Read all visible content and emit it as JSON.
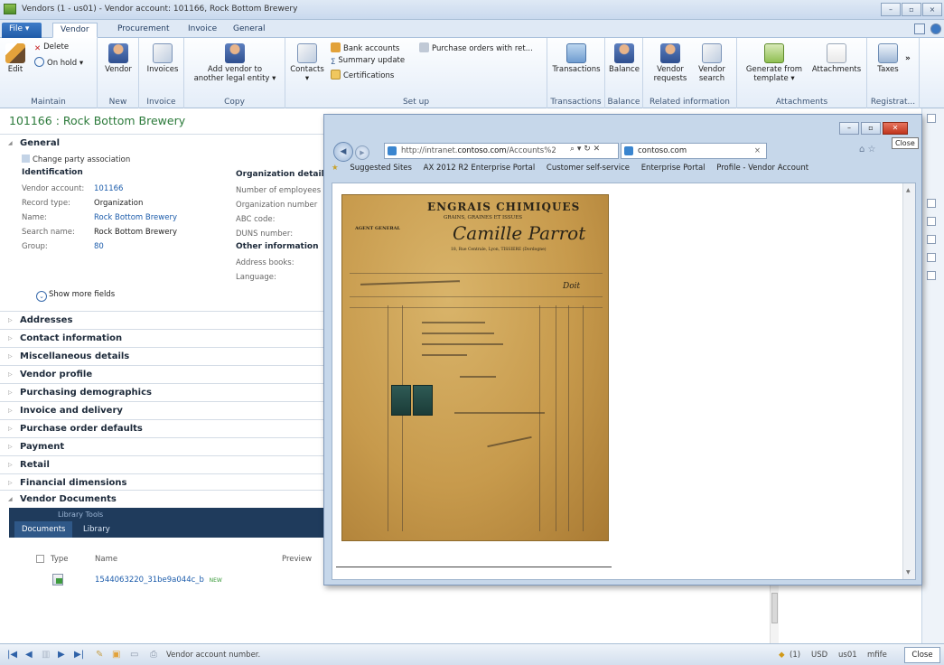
{
  "window": {
    "title": "Vendors (1 - us01) - Vendor account: 101166, Rock Bottom Brewery"
  },
  "tabs": [
    "File",
    "Vendor",
    "Procurement",
    "Invoice",
    "General"
  ],
  "ribbon": {
    "maintain": {
      "edit": "Edit",
      "delete": "Delete",
      "on_hold": "On hold",
      "label": "Maintain"
    },
    "new": {
      "vendor": "Vendor",
      "label": "New"
    },
    "invoice": {
      "invoices": "Invoices",
      "label": "Invoice"
    },
    "copy": {
      "add_vendor_1": "Add vendor to",
      "add_vendor_2": "another legal entity",
      "label": "Copy"
    },
    "setup": {
      "contacts": "Contacts",
      "bank_accounts": "Bank accounts",
      "summary_update": "Summary update",
      "certifications": "Certifications",
      "purchase_orders": "Purchase orders with ret...",
      "label": "Set up"
    },
    "transactions": {
      "btn": "Transactions",
      "label": "Transactions"
    },
    "balance": {
      "btn": "Balance",
      "label": "Balance"
    },
    "related": {
      "requests_1": "Vendor",
      "requests_2": "requests",
      "search_1": "Vendor",
      "search_2": "search",
      "label": "Related information"
    },
    "attachments": {
      "generate_1": "Generate from",
      "generate_2": "template",
      "attachments": "Attachments",
      "label": "Attachments"
    },
    "registration": {
      "taxes": "Taxes",
      "label": "Registrat..."
    }
  },
  "record": {
    "title": "101166 : Rock Bottom Brewery",
    "general": {
      "header": "General",
      "change_party": "Change party association",
      "identification": "Identification",
      "fields": [
        {
          "label": "Vendor account:",
          "value": "101166"
        },
        {
          "label": "Record type:",
          "value": "Organization"
        },
        {
          "label": "Name:",
          "value": "Rock Bottom Brewery"
        },
        {
          "label": "Search name:",
          "value": "Rock Bottom Brewery"
        },
        {
          "label": "Group:",
          "value": "80"
        }
      ],
      "org_details": "Organization details",
      "org_fields": [
        "Number of employees",
        "Organization number",
        "ABC code:",
        "DUNS number:"
      ],
      "other_info": "Other information",
      "other_fields": [
        "Address books:",
        "Language:"
      ],
      "show_more": "Show more fields"
    },
    "sections": [
      "Addresses",
      "Contact information",
      "Miscellaneous details",
      "Vendor profile",
      "Purchasing demographics",
      "Invoice and delivery",
      "Purchase order defaults",
      "Payment",
      "Retail",
      "Financial dimensions",
      "Vendor Documents"
    ],
    "documents": {
      "library_tools": "Library Tools",
      "tab_documents": "Documents",
      "tab_library": "Library",
      "col_type": "Type",
      "col_name": "Name",
      "col_preview": "Preview",
      "file_name": "1544063220_31be9a044c_b",
      "new_badge": "NEW"
    }
  },
  "browser": {
    "url_prefix": "http://intranet.",
    "url_domain": "contoso.com",
    "url_suffix": "/Accounts%2",
    "tab_title": "contoso.com",
    "close_tooltip": "Close",
    "favorites": [
      "Suggested Sites",
      "AX 2012 R2 Enterprise Portal",
      "Customer self-service",
      "Enterprise Portal",
      "Profile - Vendor Account"
    ]
  },
  "invoice_image": {
    "heading": "ENGRAIS CHIMIQUES",
    "subheading": "GRAINS, GRAINES ET ISSUES",
    "signature": "Camille Parrot",
    "address": "18, Rue Centrale, Lyon, TISSIERE (Dordogne)",
    "side_title": "AGENT GENERAL",
    "doit": "Doit"
  },
  "status": {
    "text": "Vendor account number.",
    "count": "(1)",
    "currency": "USD",
    "company": "us01",
    "user": "mfife",
    "close": "Close"
  }
}
